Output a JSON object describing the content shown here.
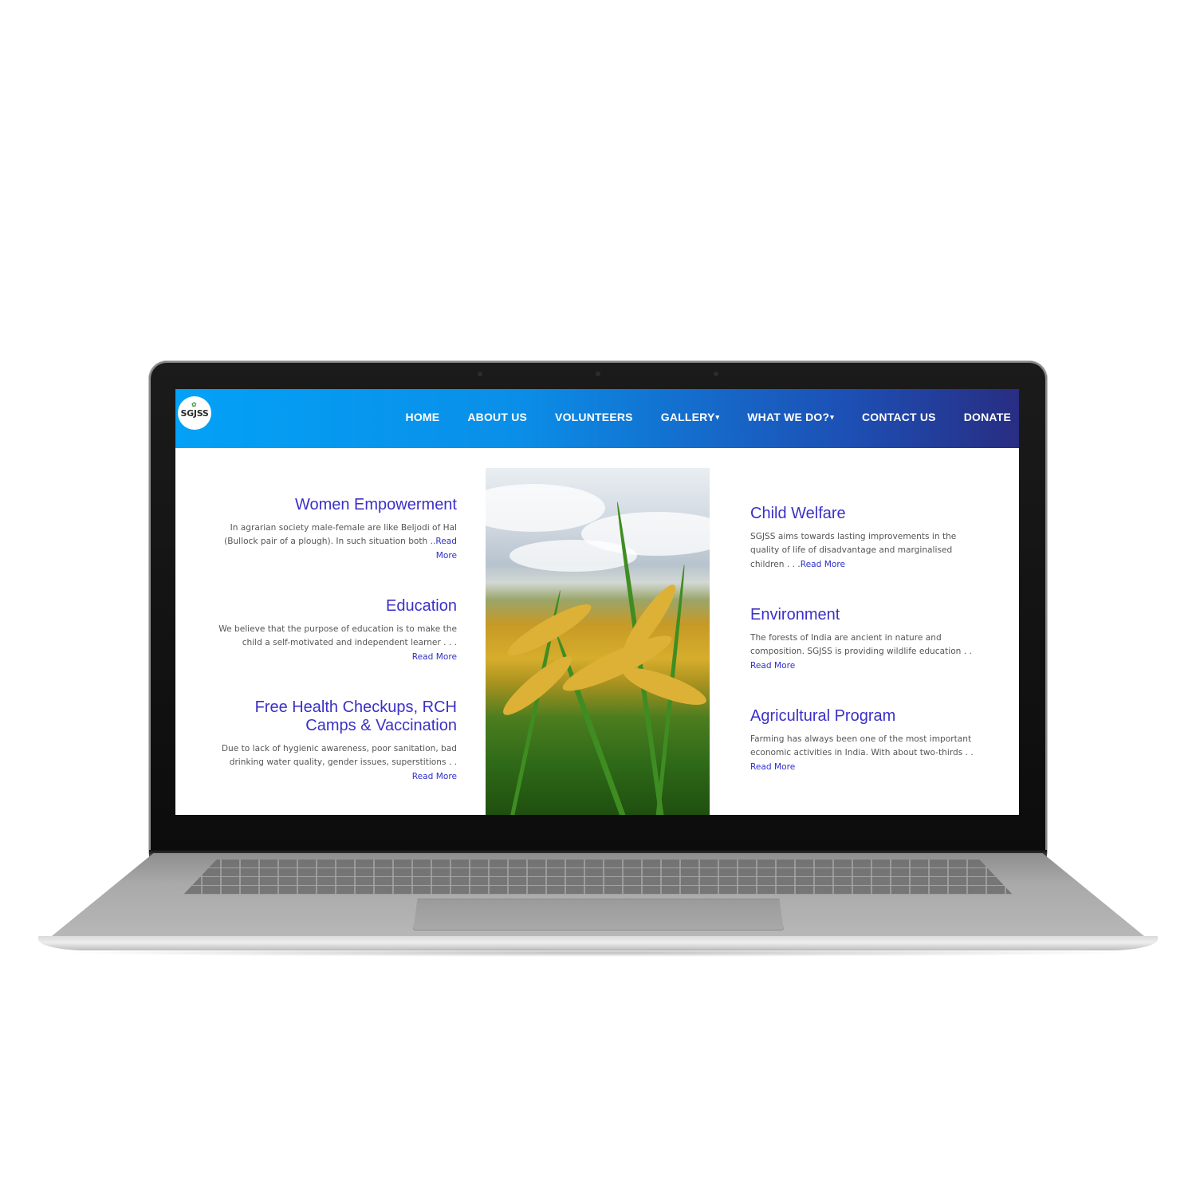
{
  "site": {
    "logo_text": "SGJSS",
    "nav": [
      {
        "label": "HOME",
        "dropdown": false
      },
      {
        "label": "ABOUT US",
        "dropdown": false
      },
      {
        "label": "VOLUNTEERS",
        "dropdown": false
      },
      {
        "label": "GALLERY",
        "dropdown": true
      },
      {
        "label": "WHAT WE DO?",
        "dropdown": true
      },
      {
        "label": "CONTACT US",
        "dropdown": false
      },
      {
        "label": "DONATE",
        "dropdown": false
      }
    ],
    "dropdown_caret": "▾",
    "left_items": [
      {
        "title": "Women Empowerment",
        "text": "In agrarian society male-female are like Beljodi of Hal (Bullock pair of a plough). In such situation both ..",
        "link": "Read More"
      },
      {
        "title": "Education",
        "text": "We believe that the purpose of education is to make the child a self-motivated and independent learner . . .",
        "link": "Read More"
      },
      {
        "title": "Free Health Checkups, RCH Camps & Vaccination",
        "text": "Due to lack of hygienic awareness, poor sanitation, bad drinking water quality, gender issues, superstitions . .",
        "link": "Read More"
      }
    ],
    "right_items": [
      {
        "title": "Child Welfare",
        "text": "SGJSS aims towards lasting improvements in the quality of life of disadvantage and marginalised children . . .",
        "link": "Read More"
      },
      {
        "title": "Environment",
        "text": "The forests of India are ancient in nature and composition. SGJSS is providing wildlife education . .",
        "link": "Read More"
      },
      {
        "title": "Agricultural Program",
        "text": "Farming has always been one of the most important economic activities in India. With about two-thirds . .",
        "link": "Read More"
      }
    ],
    "colors": {
      "nav_start": "#03a1f7",
      "nav_end": "#282d82",
      "heading": "#3b30c7",
      "link": "#2e2fc9"
    }
  }
}
